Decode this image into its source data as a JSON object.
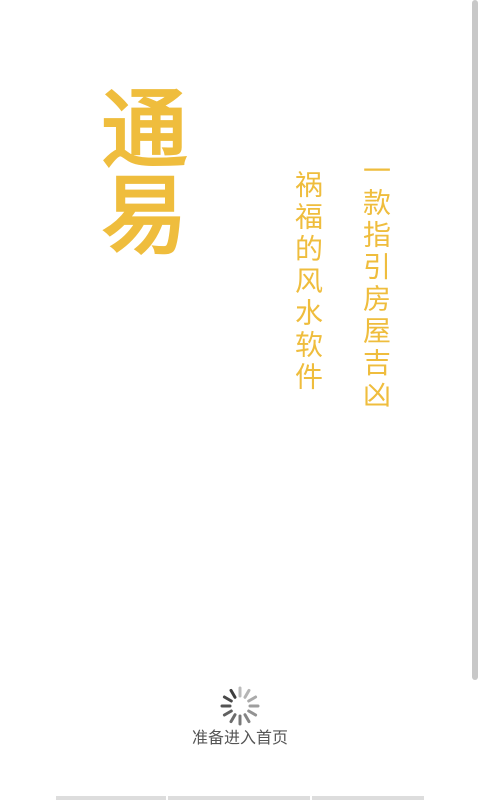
{
  "app": {
    "logo_text": "通易",
    "tagline_line1": "一款指引房屋吉凶",
    "tagline_line2": "祸福的风水软件"
  },
  "loading": {
    "text": "准备进入首页",
    "icon": "spinner-icon"
  },
  "colors": {
    "accent": "#efbd3d",
    "text_gray": "#555555",
    "background": "#ffffff"
  }
}
